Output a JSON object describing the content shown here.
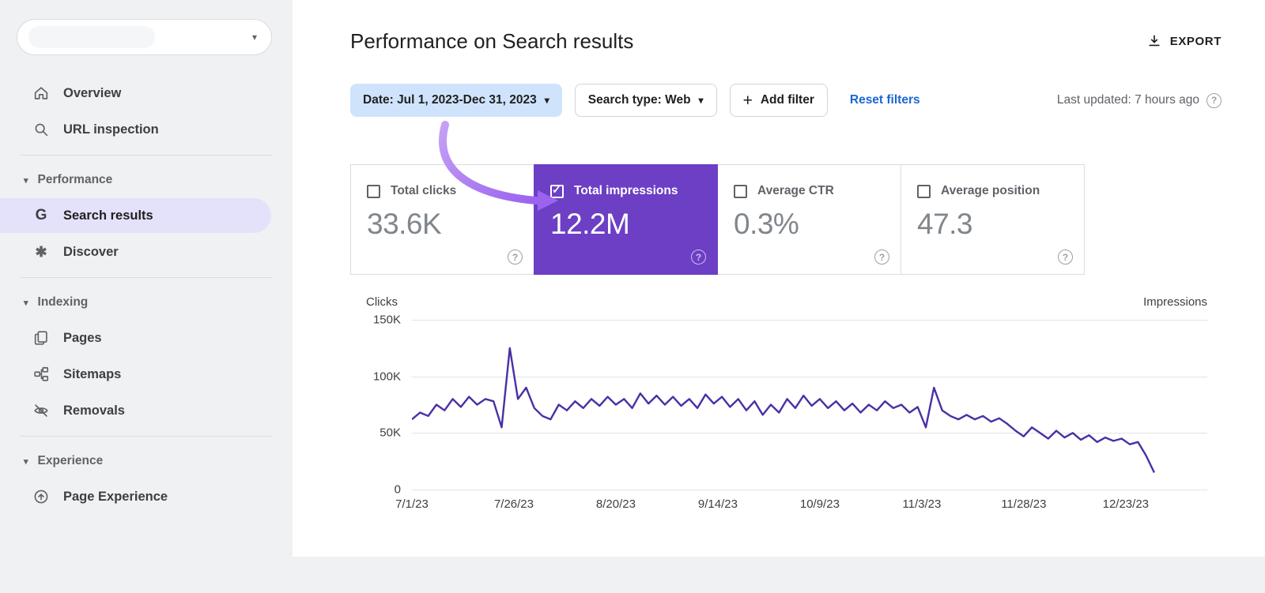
{
  "header": {
    "title": "Performance on Search results",
    "export_label": "EXPORT"
  },
  "sidebar": {
    "top_items": [
      {
        "label": "Overview",
        "icon": "home-icon"
      },
      {
        "label": "URL inspection",
        "icon": "search-icon"
      }
    ],
    "sections": [
      {
        "label": "Performance",
        "items": [
          {
            "label": "Search results",
            "icon": "google-g-icon",
            "selected": true
          },
          {
            "label": "Discover",
            "icon": "discover-asterisk-icon",
            "selected": false
          }
        ]
      },
      {
        "label": "Indexing",
        "items": [
          {
            "label": "Pages",
            "icon": "pages-icon",
            "selected": false
          },
          {
            "label": "Sitemaps",
            "icon": "sitemaps-icon",
            "selected": false
          },
          {
            "label": "Removals",
            "icon": "removals-eye-off-icon",
            "selected": false
          }
        ]
      },
      {
        "label": "Experience",
        "items": [
          {
            "label": "Page Experience",
            "icon": "page-experience-icon",
            "selected": false
          }
        ]
      }
    ]
  },
  "filter_bar": {
    "date_filter": "Date: Jul 1, 2023-Dec 31, 2023",
    "search_type_filter": "Search type: Web",
    "add_filter_label": "Add filter",
    "reset_filters_label": "Reset filters",
    "last_updated": "Last updated: 7 hours ago"
  },
  "metrics": [
    {
      "label": "Total clicks",
      "value": "33.6K",
      "checked": false
    },
    {
      "label": "Total impressions",
      "value": "12.2M",
      "checked": true
    },
    {
      "label": "Average CTR",
      "value": "0.3%",
      "checked": false
    },
    {
      "label": "Average position",
      "value": "47.3",
      "checked": false
    }
  ],
  "chart_data": {
    "type": "line",
    "title": "Performance on Search results",
    "axis_left_label": "Clicks",
    "axis_right_label": "Impressions",
    "y_tick_labels": [
      "150K",
      "100K",
      "50K",
      "0"
    ],
    "ylim": [
      0,
      150000
    ],
    "grid": "horizontal",
    "x_tick_labels": [
      "7/1/23",
      "7/26/23",
      "8/20/23",
      "9/14/23",
      "10/9/23",
      "11/3/23",
      "11/28/23",
      "12/23/23"
    ],
    "x_tick_days": [
      0,
      25,
      50,
      75,
      100,
      125,
      150,
      175
    ],
    "total_days": 182,
    "x_scale_span_days": 195,
    "series": [
      {
        "name": "Total impressions",
        "color": "#4a2fa5",
        "values": [
          62000,
          68000,
          65000,
          75000,
          70000,
          80000,
          73000,
          82000,
          75000,
          80000,
          78000,
          55000,
          125000,
          80000,
          90000,
          72000,
          65000,
          62000,
          75000,
          70000,
          78000,
          72000,
          80000,
          74000,
          82000,
          75000,
          80000,
          72000,
          85000,
          76000,
          83000,
          75000,
          82000,
          74000,
          80000,
          72000,
          84000,
          76000,
          82000,
          73000,
          80000,
          70000,
          78000,
          66000,
          75000,
          68000,
          80000,
          72000,
          83000,
          74000,
          80000,
          72000,
          78000,
          70000,
          76000,
          68000,
          75000,
          70000,
          78000,
          72000,
          75000,
          68000,
          73000,
          55000,
          90000,
          70000,
          65000,
          62000,
          66000,
          62000,
          65000,
          60000,
          63000,
          58000,
          52000,
          47000,
          55000,
          50000,
          45000,
          52000,
          46000,
          50000,
          44000,
          48000,
          42000,
          46000,
          43000,
          45000,
          40000,
          42000,
          30000,
          15000
        ]
      }
    ]
  },
  "glyphs": {
    "caret_down": "▾",
    "section_caret": "▾",
    "plus": "+",
    "help": "?",
    "asterisk": "✱",
    "google_g": "G"
  },
  "colors": {
    "impressions_purple": "#6c3fc5",
    "line_purple": "#4a2fa5",
    "chip_blue_bg": "#cfe4fc",
    "link_blue": "#1a66d2",
    "selected_nav_bg": "#e4e1fa",
    "arrow_purple": "#9b63ee"
  }
}
